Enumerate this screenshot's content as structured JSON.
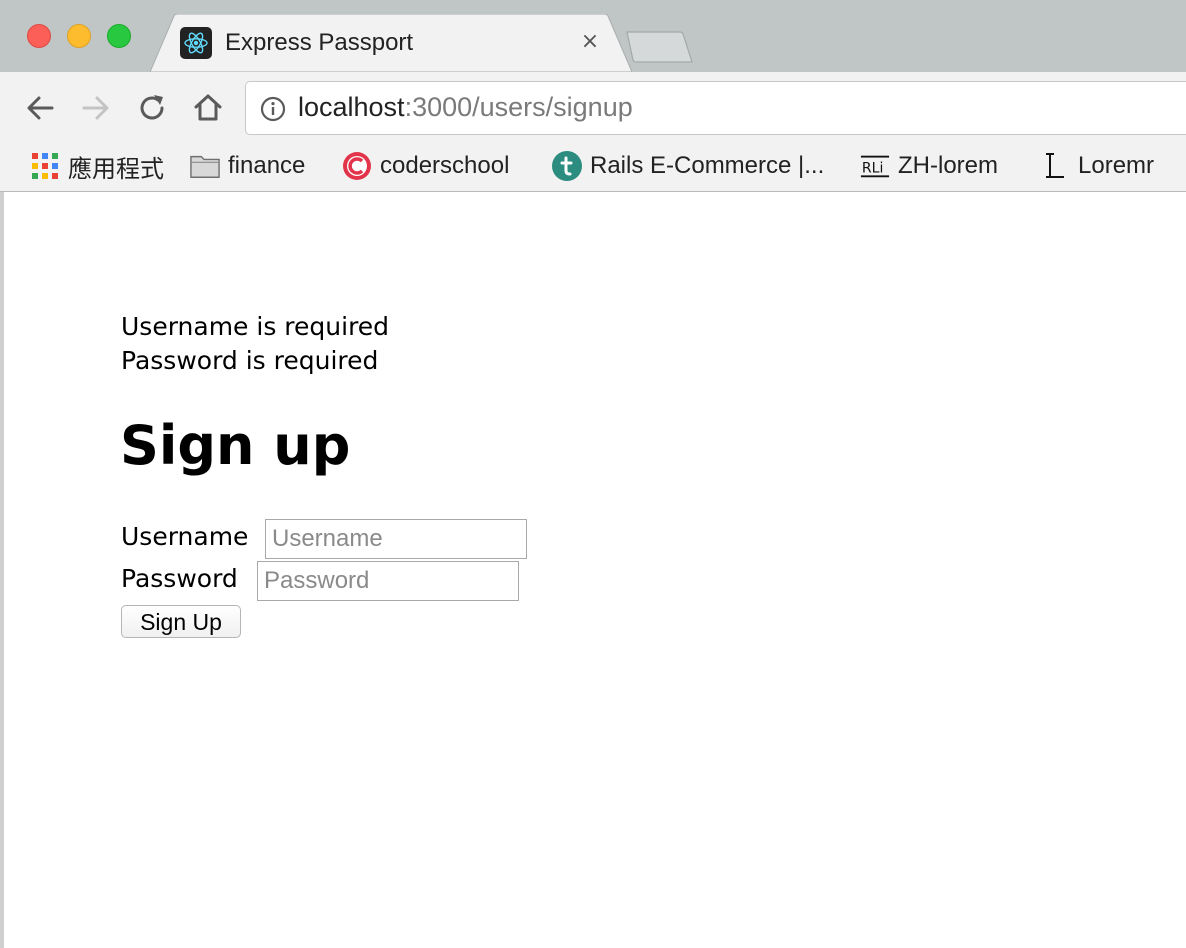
{
  "browser": {
    "tab": {
      "title": "Express Passport",
      "close_glyph": "×",
      "favicon": "react-icon"
    },
    "address_bar": {
      "host": "localhost",
      "rest": ":3000/users/signup"
    },
    "bookmarks": [
      {
        "label": "應用程式",
        "icon": "apps-grid-icon"
      },
      {
        "label": "finance",
        "icon": "folder-icon"
      },
      {
        "label": "coderschool",
        "icon": "coderschool-icon"
      },
      {
        "label": "Rails E-Commerce |...",
        "icon": "teal-t-icon"
      },
      {
        "label": "ZH-lorem",
        "icon": "rli-icon"
      },
      {
        "label": "Loremr",
        "icon": "l-serif-icon"
      }
    ],
    "colors": {
      "close": "#fc5f57",
      "minimize": "#fdbc2e",
      "maximize": "#28c840",
      "titlebar": "#c0c6c6",
      "toolbar": "#f2f2f2"
    }
  },
  "page": {
    "errors": [
      "Username is required",
      "Password is required"
    ],
    "heading": "Sign up",
    "form": {
      "username_label": "Username",
      "username_placeholder": "Username",
      "password_label": "Password",
      "password_placeholder": "Password",
      "submit_label": "Sign Up"
    }
  }
}
